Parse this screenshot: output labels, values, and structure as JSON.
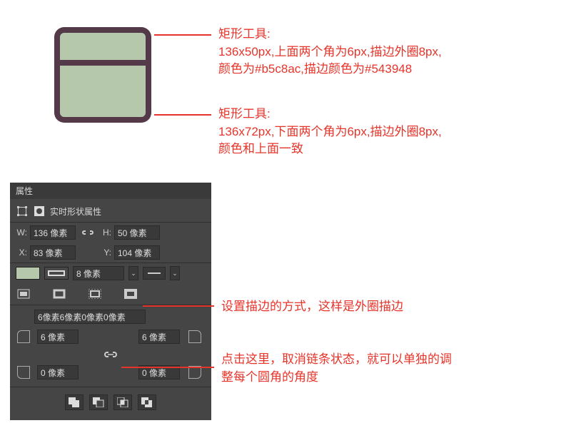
{
  "callouts": {
    "top": {
      "title": "矩形工具:",
      "desc1": "136x50px,上面两个角为6px,描边外圈8px,",
      "desc2": "颜色为#b5c8ac,描边颜色为#543948"
    },
    "bottom": {
      "title": "矩形工具:",
      "desc1": "136x72px,下面两个角为6px,描边外圈8px,",
      "desc2": "颜色和上面一致"
    },
    "stroke_align": "设置描边的方式，这样是外圈描边",
    "link_note1": "点击这里，取消链条状态，就可以单独的调",
    "link_note2": "整每个圆角的角度"
  },
  "panel": {
    "title": "属性",
    "subtitle": "实时形状属性",
    "W_label": "W:",
    "W_value": "136 像素",
    "H_label": "H:",
    "H_value": "50 像素",
    "X_label": "X:",
    "X_value": "83 像素",
    "Y_label": "Y:",
    "Y_value": "104 像素",
    "stroke_size": "8 像素",
    "corner_summary": "6像素6像素0像素0像素",
    "corners": {
      "tl": "6 像素",
      "tr": "6 像素",
      "bl": "0 像素",
      "br": "0 像素"
    }
  },
  "colors": {
    "fill": "#b5c8ac",
    "stroke": "#543948",
    "accent": "#e6342a"
  }
}
